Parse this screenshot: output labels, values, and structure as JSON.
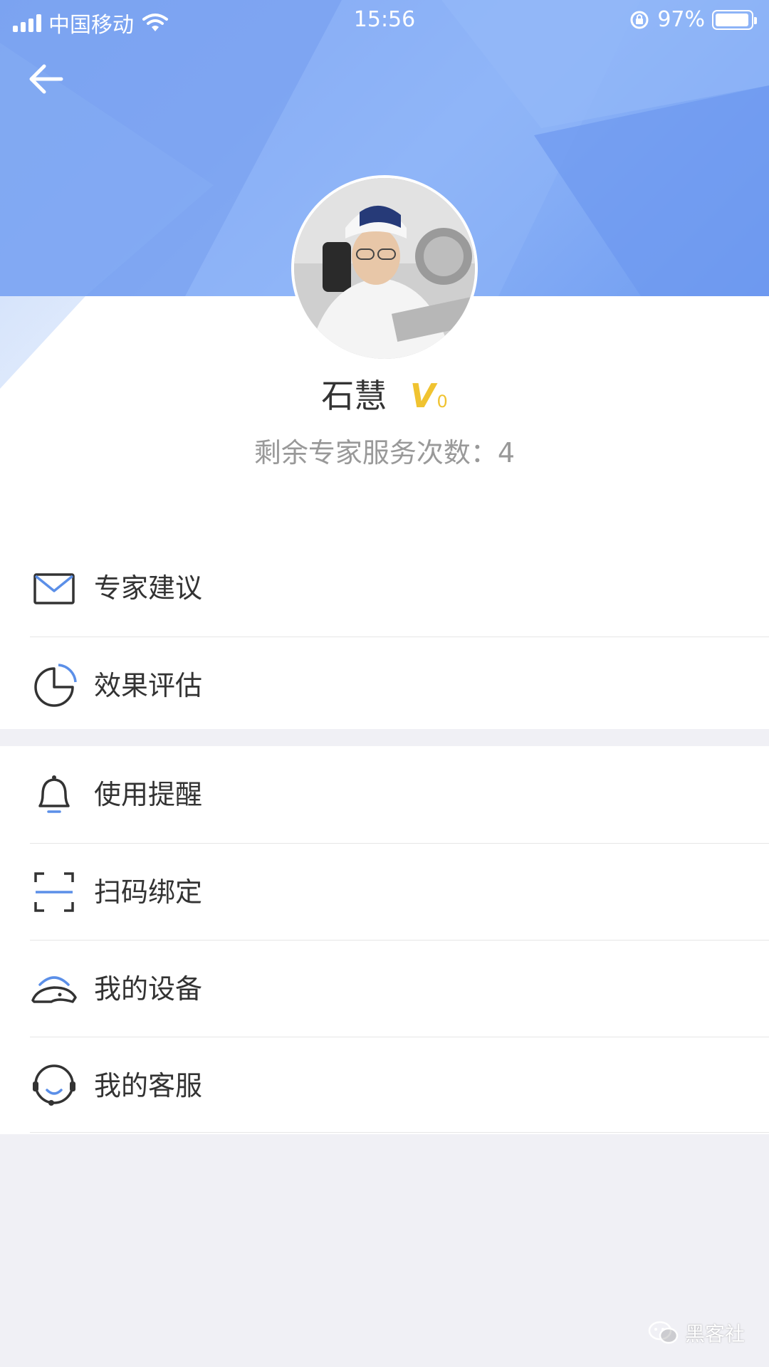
{
  "status_bar": {
    "carrier": "中国移动",
    "time": "15:56",
    "battery_percent": "97%"
  },
  "profile": {
    "name": "石慧",
    "vip_badge": "V",
    "vip_level": "0",
    "remaining_label": "剩余专家服务次数：",
    "remaining_count": "4"
  },
  "menu": {
    "group1": [
      {
        "label": "专家建议",
        "icon": "mail-icon"
      },
      {
        "label": "效果评估",
        "icon": "pie-chart-icon"
      }
    ],
    "group2": [
      {
        "label": "使用提醒",
        "icon": "bell-icon"
      },
      {
        "label": "扫码绑定",
        "icon": "scan-icon"
      },
      {
        "label": "我的设备",
        "icon": "helmet-icon"
      },
      {
        "label": "我的客服",
        "icon": "headset-icon"
      }
    ]
  },
  "watermark": {
    "text": "黑客社"
  },
  "colors": {
    "header_blue": "#7ea6f2",
    "accent_blue": "#5b8fe8",
    "vip_gold": "#f0c330"
  }
}
